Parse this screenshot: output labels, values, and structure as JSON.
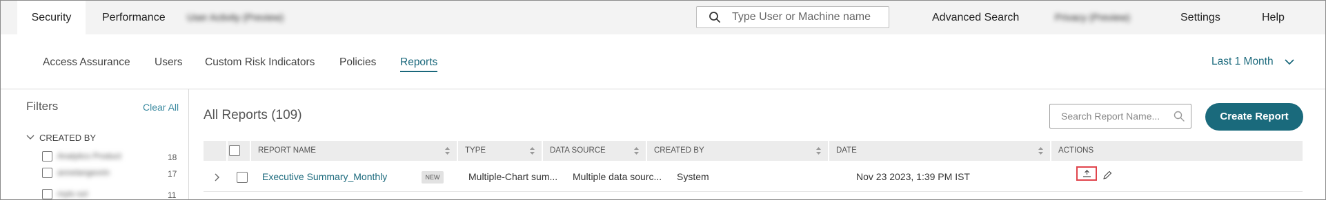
{
  "topnav": {
    "tabs": [
      {
        "label": "Security",
        "active": true
      },
      {
        "label": "Performance",
        "active": false
      },
      {
        "label": "User Activity (Preview)",
        "active": false,
        "obscured": true
      }
    ],
    "search_placeholder": "Type User or Machine name",
    "right_links": [
      {
        "label": "Advanced Search"
      },
      {
        "label": "Privacy (Preview)",
        "obscured": true
      },
      {
        "label": "Settings"
      },
      {
        "label": "Help"
      }
    ]
  },
  "subnav": {
    "items": [
      {
        "label": "Access Assurance"
      },
      {
        "label": "Users"
      },
      {
        "label": "Custom Risk Indicators"
      },
      {
        "label": "Policies"
      },
      {
        "label": "Reports",
        "active": true
      }
    ],
    "time_filter": "Last 1 Month"
  },
  "sidebar": {
    "title": "Filters",
    "clear_all": "Clear All",
    "group_label": "CREATED BY",
    "options": [
      {
        "label": "Analytics Product",
        "count": "18",
        "obscured": true
      },
      {
        "label": "annelangeorin",
        "count": "17",
        "obscured": true
      },
      {
        "label": "mylo sol",
        "count": "11",
        "obscured": true
      }
    ]
  },
  "main": {
    "title": "All Reports (109)",
    "search_placeholder": "Search Report Name...",
    "create_button": "Create Report",
    "columns": [
      "REPORT NAME",
      "TYPE",
      "DATA SOURCE",
      "CREATED BY",
      "DATE",
      "ACTIONS"
    ],
    "rows": [
      {
        "name": "Executive Summary_Monthly",
        "badge": "NEW",
        "type": "Multiple-Chart sum...",
        "data_source": "Multiple data sourc...",
        "created_by": "System",
        "date": "Nov 23 2023, 1:39 PM IST",
        "actions": [
          "export-icon",
          "edit-icon"
        ]
      }
    ]
  },
  "colors": {
    "accent": "#1a6a7c",
    "link": "#1c6a7d",
    "highlight_border": "#e0434b",
    "nav_bg": "#f3f3f3",
    "header_bg": "#ececec"
  }
}
